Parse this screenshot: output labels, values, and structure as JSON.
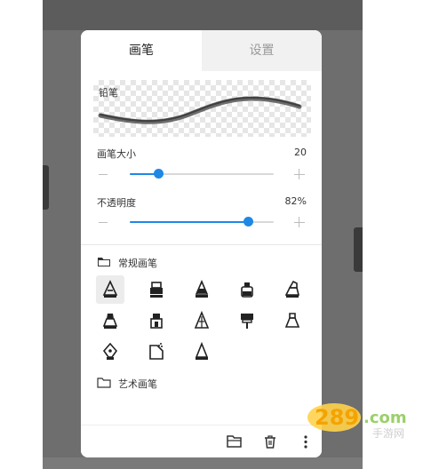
{
  "tabs": {
    "brush": "画笔",
    "settings": "设置"
  },
  "preview": {
    "label": "铅笔"
  },
  "size": {
    "label": "画笔大小",
    "value": "20",
    "level_percent": 20
  },
  "opacity": {
    "label": "不透明度",
    "value": "82%",
    "level_percent": 82
  },
  "sections": {
    "regular": "常规画笔",
    "art": "艺术画笔"
  },
  "brushes": [
    {
      "icon": "pencil-icon",
      "selected": true
    },
    {
      "icon": "marker-icon"
    },
    {
      "icon": "cone-brush-icon"
    },
    {
      "icon": "ink-bottle-icon"
    },
    {
      "icon": "chisel-marker-icon"
    },
    {
      "icon": "wide-brush-icon"
    },
    {
      "icon": "stamp-brush-icon"
    },
    {
      "icon": "crayon-icon"
    },
    {
      "icon": "paint-brush-icon"
    },
    {
      "icon": "outline-brush-icon"
    },
    {
      "icon": "pen-nib-icon"
    },
    {
      "icon": "spray-icon"
    },
    {
      "icon": "triangle-brush-icon"
    }
  ],
  "colors": {
    "accent": "#1e88e5"
  },
  "watermark": "289.com 手游网"
}
